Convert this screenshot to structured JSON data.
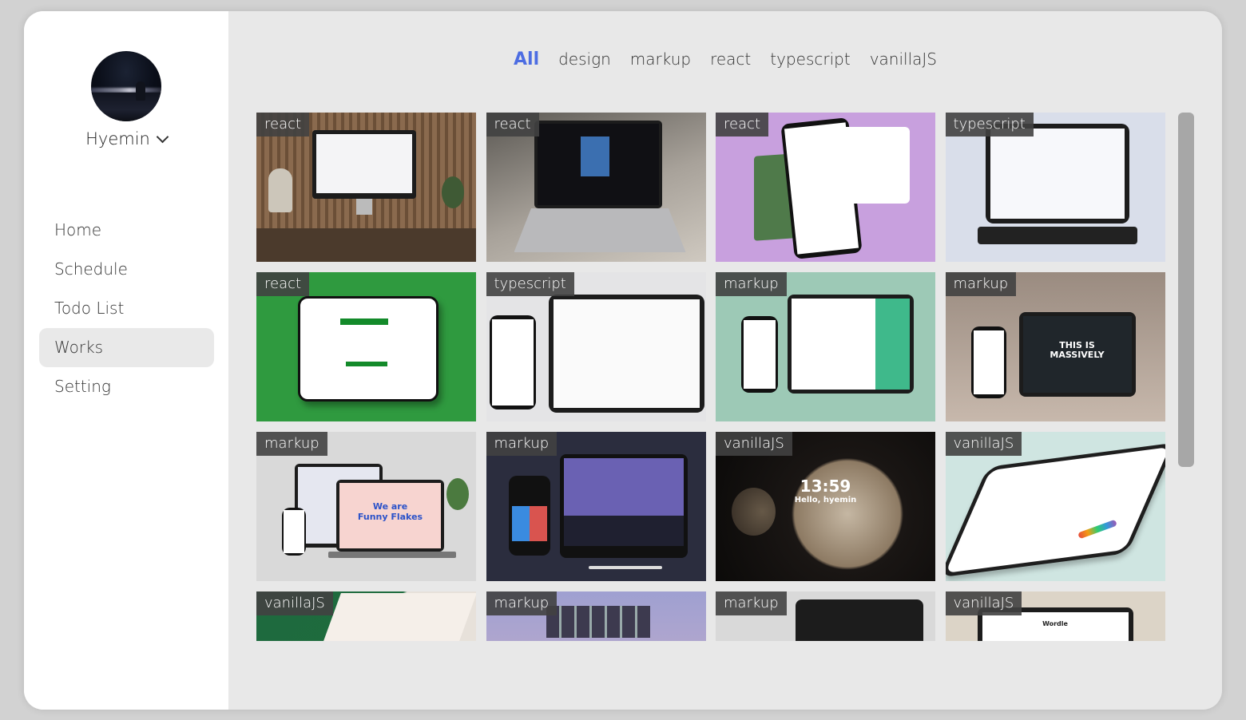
{
  "sidebar": {
    "user_name": "Hyemin",
    "nav": [
      {
        "label": "Home"
      },
      {
        "label": "Schedule"
      },
      {
        "label": "Todo List"
      },
      {
        "label": "Works"
      },
      {
        "label": "Setting"
      }
    ]
  },
  "filters": [
    {
      "label": "All"
    },
    {
      "label": "design"
    },
    {
      "label": "markup"
    },
    {
      "label": "react"
    },
    {
      "label": "typescript"
    },
    {
      "label": "vanillaJS"
    }
  ],
  "works": [
    {
      "tag": "react"
    },
    {
      "tag": "react"
    },
    {
      "tag": "react"
    },
    {
      "tag": "typescript"
    },
    {
      "tag": "react"
    },
    {
      "tag": "typescript"
    },
    {
      "tag": "markup"
    },
    {
      "tag": "markup",
      "text": [
        "THIS IS",
        "MASSIVELY"
      ]
    },
    {
      "tag": "markup",
      "text": [
        "We are",
        "Funny Flakes"
      ]
    },
    {
      "tag": "markup"
    },
    {
      "tag": "vanillaJS",
      "text": [
        "13:59",
        "Hello, hyemin"
      ]
    },
    {
      "tag": "vanillaJS"
    },
    {
      "tag": "vanillaJS"
    },
    {
      "tag": "markup"
    },
    {
      "tag": "markup"
    },
    {
      "tag": "vanillaJS",
      "text": [
        "Wordle"
      ]
    }
  ],
  "colors": {
    "accent": "#4d6de2",
    "sidebar_active": "#e9e9e9",
    "tag_bg": "#414141"
  }
}
